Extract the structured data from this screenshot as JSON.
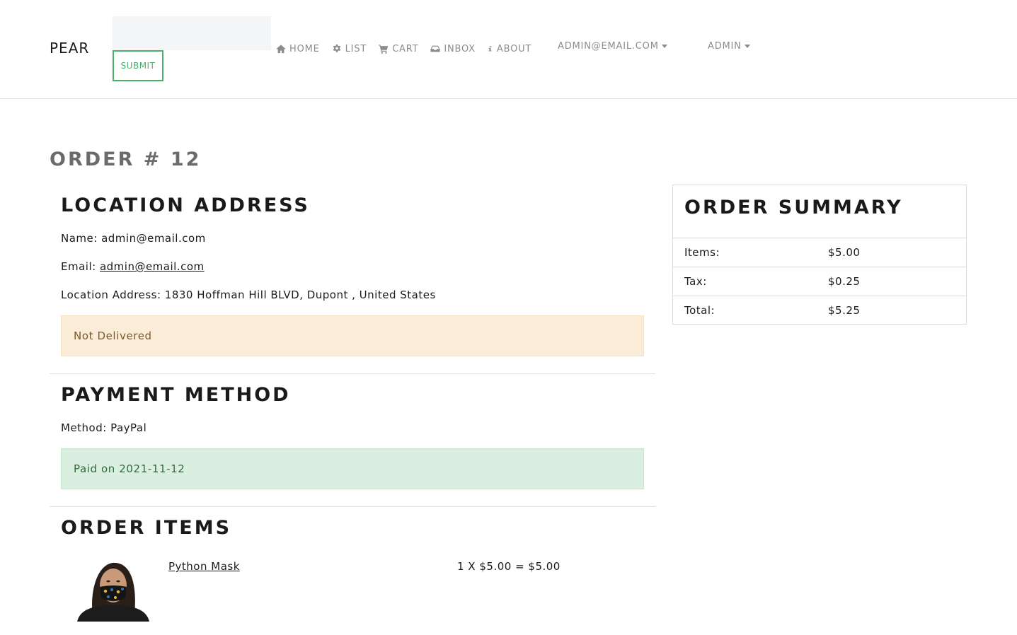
{
  "nav": {
    "brand": "PEAR",
    "search_placeholder": "",
    "submit_label": "SUBMIT",
    "links": {
      "home": "HOME",
      "list": "LIST",
      "cart": "CART",
      "inbox": "INBOX",
      "about": "ABOUT"
    },
    "user_menu": "ADMIN@EMAIL.COM",
    "admin_menu": "ADMIN"
  },
  "page": {
    "title": "ORDER # 12"
  },
  "location": {
    "heading": "LOCATION ADDRESS",
    "name_label": "Name:",
    "name_value": "admin@email.com",
    "email_label": "Email:",
    "email_value": "admin@email.com",
    "address_label": "Location Address:",
    "address_value": "1830 Hoffman Hill BLVD, Dupont , United States",
    "status": "Not Delivered"
  },
  "payment": {
    "heading": "PAYMENT METHOD",
    "method_label": "Method:",
    "method_value": "PayPal",
    "status": "Paid on 2021-11-12"
  },
  "items": {
    "heading": "ORDER ITEMS",
    "list": [
      {
        "name": "Python Mask",
        "price_line": "1 X $5.00 = $5.00"
      }
    ]
  },
  "summary": {
    "heading": "ORDER SUMMARY",
    "rows": [
      {
        "label": "Items:",
        "value": "$5.00"
      },
      {
        "label": "Tax:",
        "value": "$0.25"
      },
      {
        "label": "Total:",
        "value": "$5.25"
      }
    ]
  },
  "colors": {
    "accent_green": "#4caf6a",
    "warning_bg": "#faecd7",
    "success_bg": "#daefe0",
    "nav_text": "#8c8c8c"
  },
  "icons": [
    "home-icon",
    "gear-icon",
    "cart-icon",
    "inbox-icon",
    "info-icon",
    "chevron-down-icon"
  ]
}
